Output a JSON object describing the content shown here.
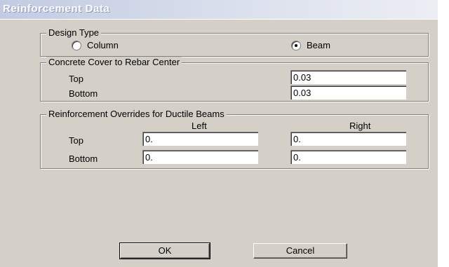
{
  "window": {
    "title": "Reinforcement Data"
  },
  "design_type": {
    "legend": "Design Type",
    "options": [
      {
        "label": "Column",
        "selected": false
      },
      {
        "label": "Beam",
        "selected": true
      }
    ]
  },
  "cover": {
    "legend": "Concrete Cover to Rebar Center",
    "top_label": "Top",
    "top_value": "0.03",
    "bottom_label": "Bottom",
    "bottom_value": "0.03"
  },
  "overrides": {
    "legend": "Reinforcement Overrides for Ductile Beams",
    "col_left": "Left",
    "col_right": "Right",
    "top_label": "Top",
    "top_left": "0.",
    "top_right": "0.",
    "bottom_label": "Bottom",
    "bottom_left": "0.",
    "bottom_right": "0."
  },
  "buttons": {
    "ok": "OK",
    "cancel": "Cancel"
  }
}
